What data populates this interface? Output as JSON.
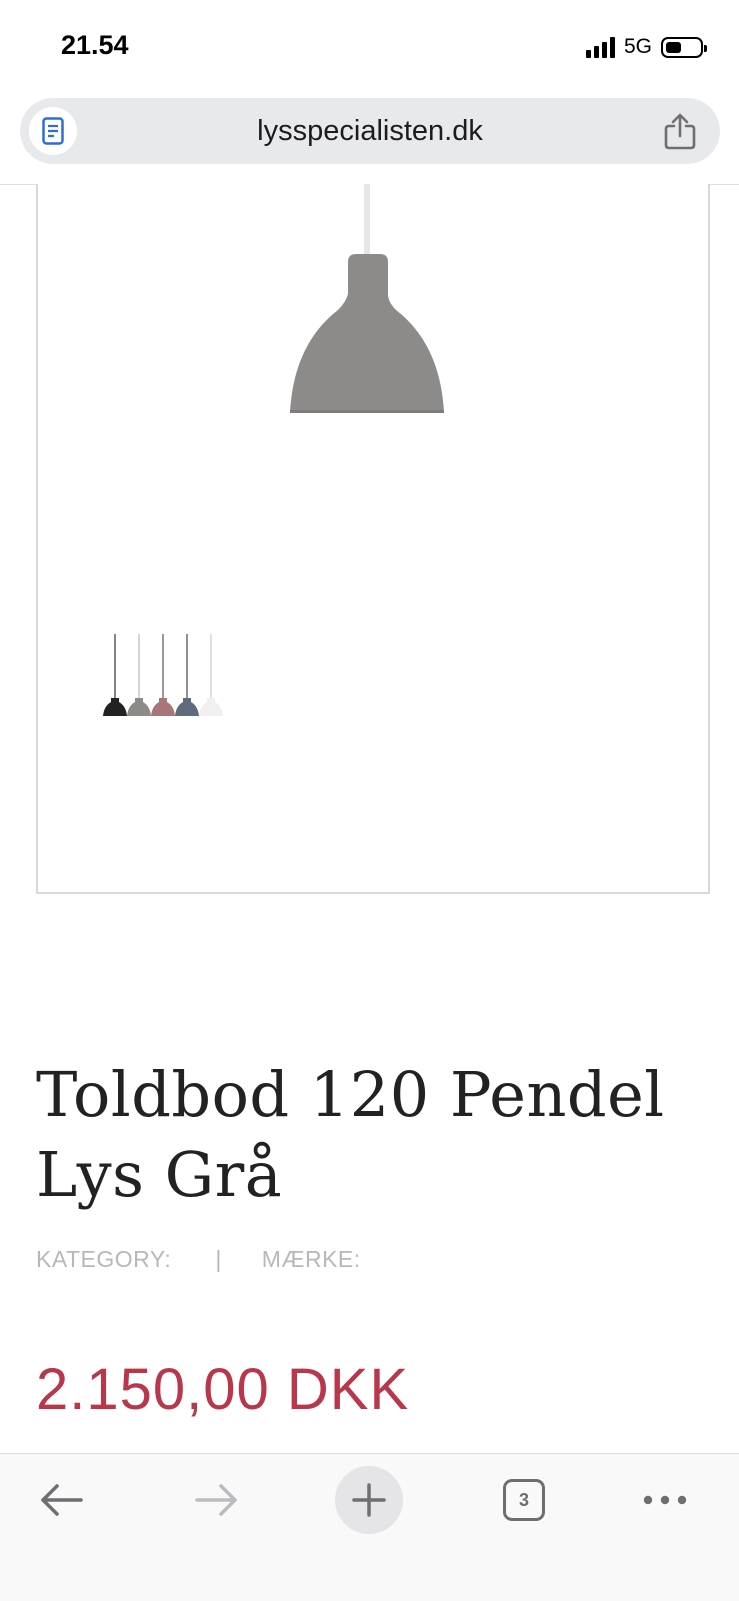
{
  "status_bar": {
    "time": "21.54",
    "network": "5G"
  },
  "browser": {
    "url": "lysspecialisten.dk",
    "reader_icon": "reader-icon",
    "share_icon": "share-icon"
  },
  "product": {
    "title_line1": "Toldbod 120 Pendel",
    "title_line2": "Lys Grå",
    "category_label": "KATEGORY:",
    "separator": "|",
    "brand_label": "MÆRKE:",
    "price": "2.150,00 DKK",
    "price_color": "#b8374a",
    "lamp_color": "#8c8b89",
    "variant_colors": [
      "#222222",
      "#8c8b89",
      "#a8757b",
      "#5f6b7a",
      "#f0f0ee"
    ]
  },
  "toolbar": {
    "back_icon": "arrow-left-icon",
    "forward_icon": "arrow-right-icon",
    "new_tab_icon": "plus-icon",
    "tab_count": "3",
    "more_icon": "more-dots-icon"
  }
}
